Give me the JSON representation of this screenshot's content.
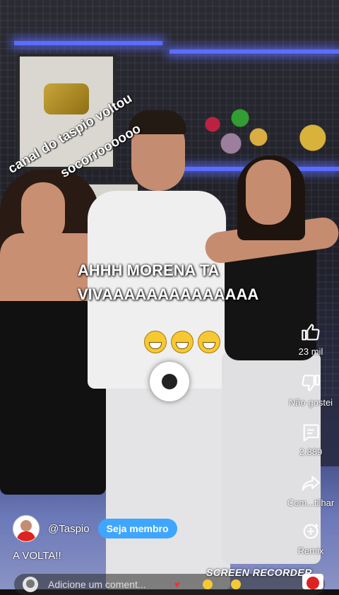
{
  "overlay": {
    "diagonal_line_1": "canal do taspio voltou",
    "diagonal_line_2": "socorroooooo",
    "caption": "AHHH MORENA TA VIVAAAAAAAAAAAAAA",
    "caption_emoji_name": "grinning-face-emoji"
  },
  "actions": {
    "like_count": "23 mil",
    "dislike_label": "Não gostei",
    "comment_count": "2.889",
    "share_label": "Com...tilhar",
    "remix_label": "Remix"
  },
  "channel": {
    "handle": "@Taspio",
    "join_label": "Seja membro",
    "video_title": "A VOLTA!!"
  },
  "comment_bar": {
    "placeholder": "Adicione um coment..."
  },
  "watermark": "SCREEN RECORDER",
  "colors": {
    "join_button": "#3ea6ff",
    "neon_light": "#5a6dff",
    "text": "#ffffff"
  },
  "icons": [
    "thumbs-up-icon",
    "thumbs-down-icon",
    "comment-icon",
    "share-icon",
    "remix-icon",
    "pause-icon"
  ]
}
